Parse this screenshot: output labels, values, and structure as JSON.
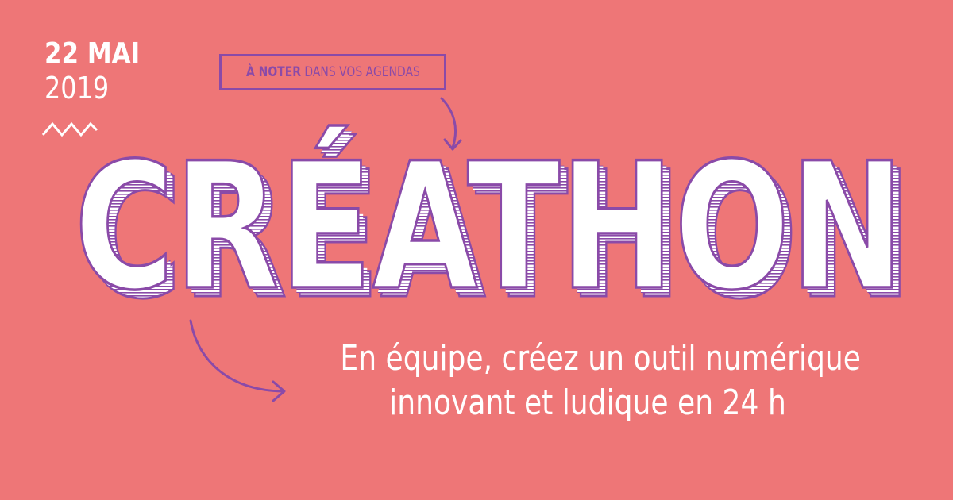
{
  "colors": {
    "background": "#ee7677",
    "accent": "#8a4aa8",
    "white": "#ffffff",
    "shadow": "#cf6f86"
  },
  "date": {
    "day_month": "22 MAI",
    "year": "2019"
  },
  "note": {
    "strong": "À NOTER",
    "rest": " DANS VOS AGENDAS"
  },
  "title": "CRÉATHON",
  "subtitle": {
    "line1": "En équipe, créez un outil numérique",
    "line2": "innovant et ludique en 24 h"
  },
  "icons": {
    "zigzag": "zigzag-icon",
    "arrow_top": "curved-arrow-down-icon",
    "arrow_left": "curved-arrow-right-icon"
  }
}
